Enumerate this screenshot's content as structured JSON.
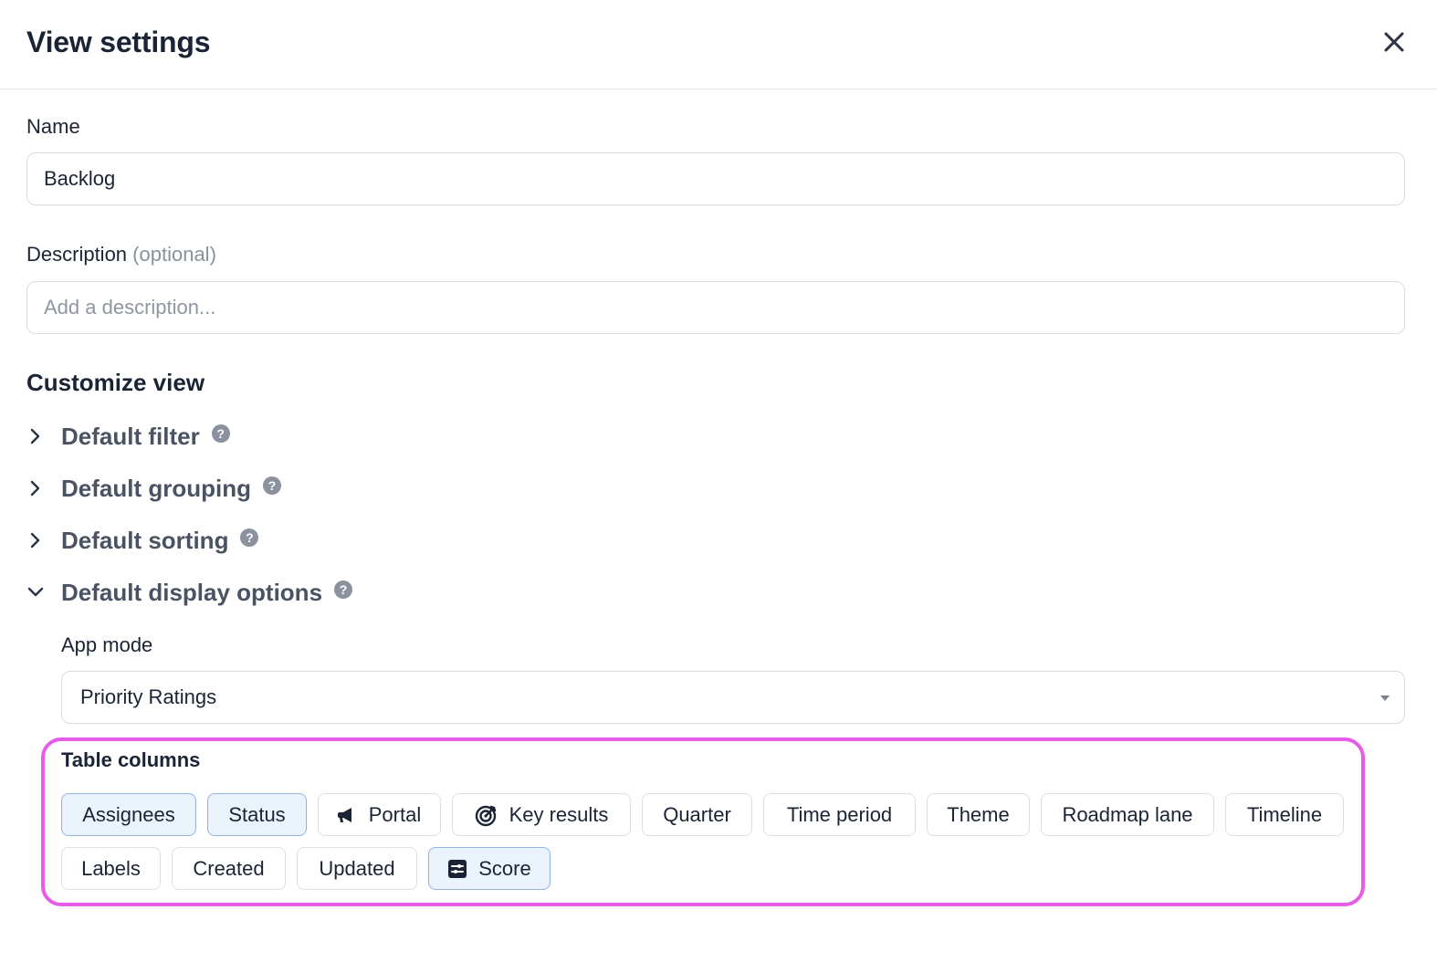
{
  "dialog": {
    "title": "View settings",
    "close_icon": "close-icon"
  },
  "name_field": {
    "label": "Name",
    "value": "Backlog"
  },
  "description_field": {
    "label": "Description",
    "optional_hint": "(optional)",
    "placeholder": "Add a description..."
  },
  "customize": {
    "title": "Customize view",
    "sections": [
      {
        "label": "Default filter",
        "expanded": false
      },
      {
        "label": "Default grouping",
        "expanded": false
      },
      {
        "label": "Default sorting",
        "expanded": false
      },
      {
        "label": "Default display options",
        "expanded": true
      }
    ],
    "help_glyph": "?"
  },
  "app_mode": {
    "label": "App mode",
    "value": "Priority Ratings"
  },
  "table_columns": {
    "title": "Table columns",
    "chips": [
      {
        "label": "Assignees",
        "active": true
      },
      {
        "label": "Status",
        "active": true
      },
      {
        "label": "Portal",
        "active": false,
        "icon": "megaphone-icon"
      },
      {
        "label": "Key results",
        "active": false,
        "icon": "target-icon"
      },
      {
        "label": "Quarter",
        "active": false
      },
      {
        "label": "Time period",
        "active": false
      },
      {
        "label": "Theme",
        "active": false
      },
      {
        "label": "Roadmap lane",
        "active": false
      },
      {
        "label": "Timeline",
        "active": false
      },
      {
        "label": "Labels",
        "active": false
      },
      {
        "label": "Created",
        "active": false
      },
      {
        "label": "Updated",
        "active": false
      },
      {
        "label": "Score",
        "active": true,
        "icon": "score-icon"
      }
    ]
  },
  "colors": {
    "highlight": "#e45ce8",
    "active_chip_bg": "#eaf2fc",
    "active_chip_border": "#8fb4e2"
  }
}
